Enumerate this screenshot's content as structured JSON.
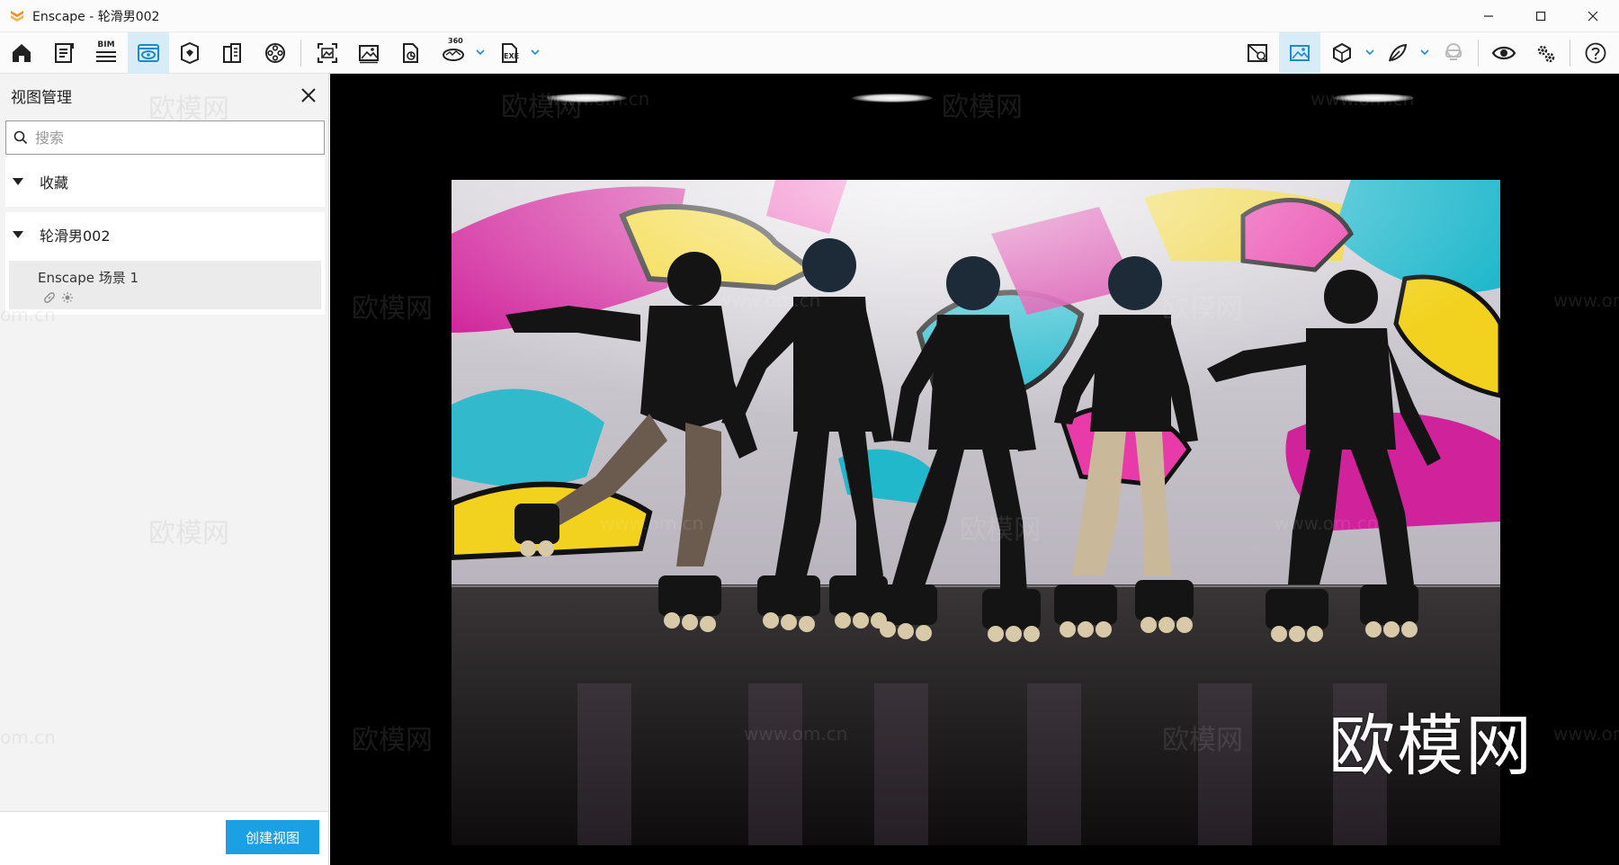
{
  "window": {
    "title": "Enscape - 轮滑男002"
  },
  "toolbar": {
    "bim_label": "BIM",
    "pano_label": "360",
    "exe_label": "EXE"
  },
  "sidebar": {
    "title": "视图管理",
    "search_placeholder": "搜索",
    "favorites_label": "收藏",
    "project_label": "轮滑男002",
    "views": [
      {
        "name": "Enscape 场景 1"
      }
    ],
    "create_button": "创建视图"
  },
  "viewport": {
    "watermark": "欧模网",
    "watermark_url": "www.om.cn",
    "watermark_url_short": "om.cn"
  },
  "colors": {
    "accent": "#1aa0e3",
    "active_tab": "#d8ecf7",
    "logo": "#f28c28"
  }
}
